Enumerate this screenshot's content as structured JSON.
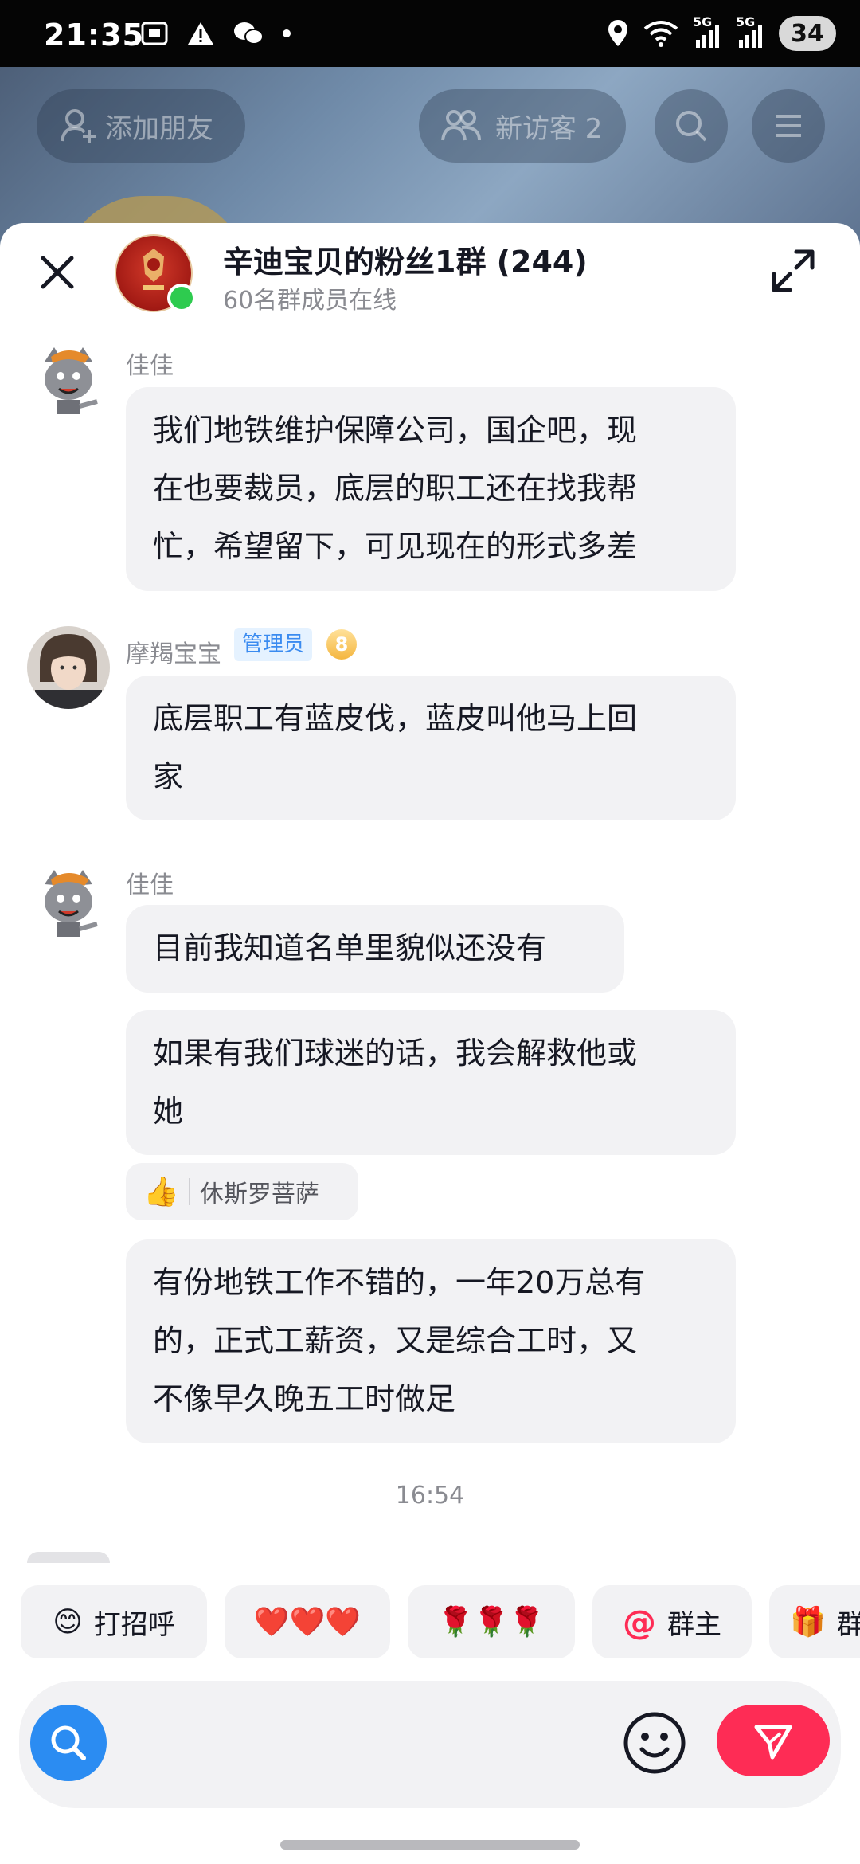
{
  "status_bar": {
    "time": "21:35",
    "signal_1": "5G",
    "signal_2": "5G",
    "battery": "34"
  },
  "background": {
    "add_friend_label": "添加朋友",
    "new_visitors_label": "新访客 2"
  },
  "group": {
    "title": "辛迪宝贝的粉丝1群 (244)",
    "subtitle": "60名群成员在线",
    "avatar_icon": "team-crest-icon"
  },
  "messages": [
    {
      "sender": "佳佳",
      "avatar_icon": "grey-wolf-avatar-icon",
      "lines": [
        "我们地铁维护保障公司，国企吧，现",
        "在也要裁员，底层的职工还在找我帮",
        "忙，希望留下，可见现在的形式多差"
      ]
    },
    {
      "sender": "摩羯宝宝",
      "badge": "管理员",
      "level": "8",
      "avatar_icon": "user-photo-avatar",
      "lines": [
        "底层职工有蓝皮伐，蓝皮叫他马上回",
        "家"
      ]
    },
    {
      "sender": "佳佳",
      "avatar_icon": "grey-wolf-avatar-icon",
      "bubbles": [
        {
          "lines": [
            "目前我知道名单里貌似还没有"
          ]
        },
        {
          "lines": [
            "如果有我们球迷的话，我会解救他或",
            "她"
          ]
        },
        {
          "lines": [
            "有份地铁工作不错的，一年20万总有",
            "的，正式工薪资，又是综合工时，又",
            "不像早久晚五工时做足"
          ]
        }
      ]
    }
  ],
  "reaction": {
    "emoji": "👍",
    "name": "休斯罗菩萨"
  },
  "timestamp": "16:54",
  "quick_replies": [
    {
      "emoji": "😊",
      "label": "打招呼"
    },
    {
      "emoji": "",
      "label": "❤️❤️❤️"
    },
    {
      "emoji": "",
      "label": "🌹🌹🌹"
    },
    {
      "emoji": "@",
      "label": "群主"
    },
    {
      "emoji": "🎁",
      "label": "群"
    }
  ],
  "colors": {
    "accent": "#fe2c55",
    "search": "#2b8cf2",
    "online": "#2ecb4f",
    "bubble": "#f2f2f4"
  }
}
